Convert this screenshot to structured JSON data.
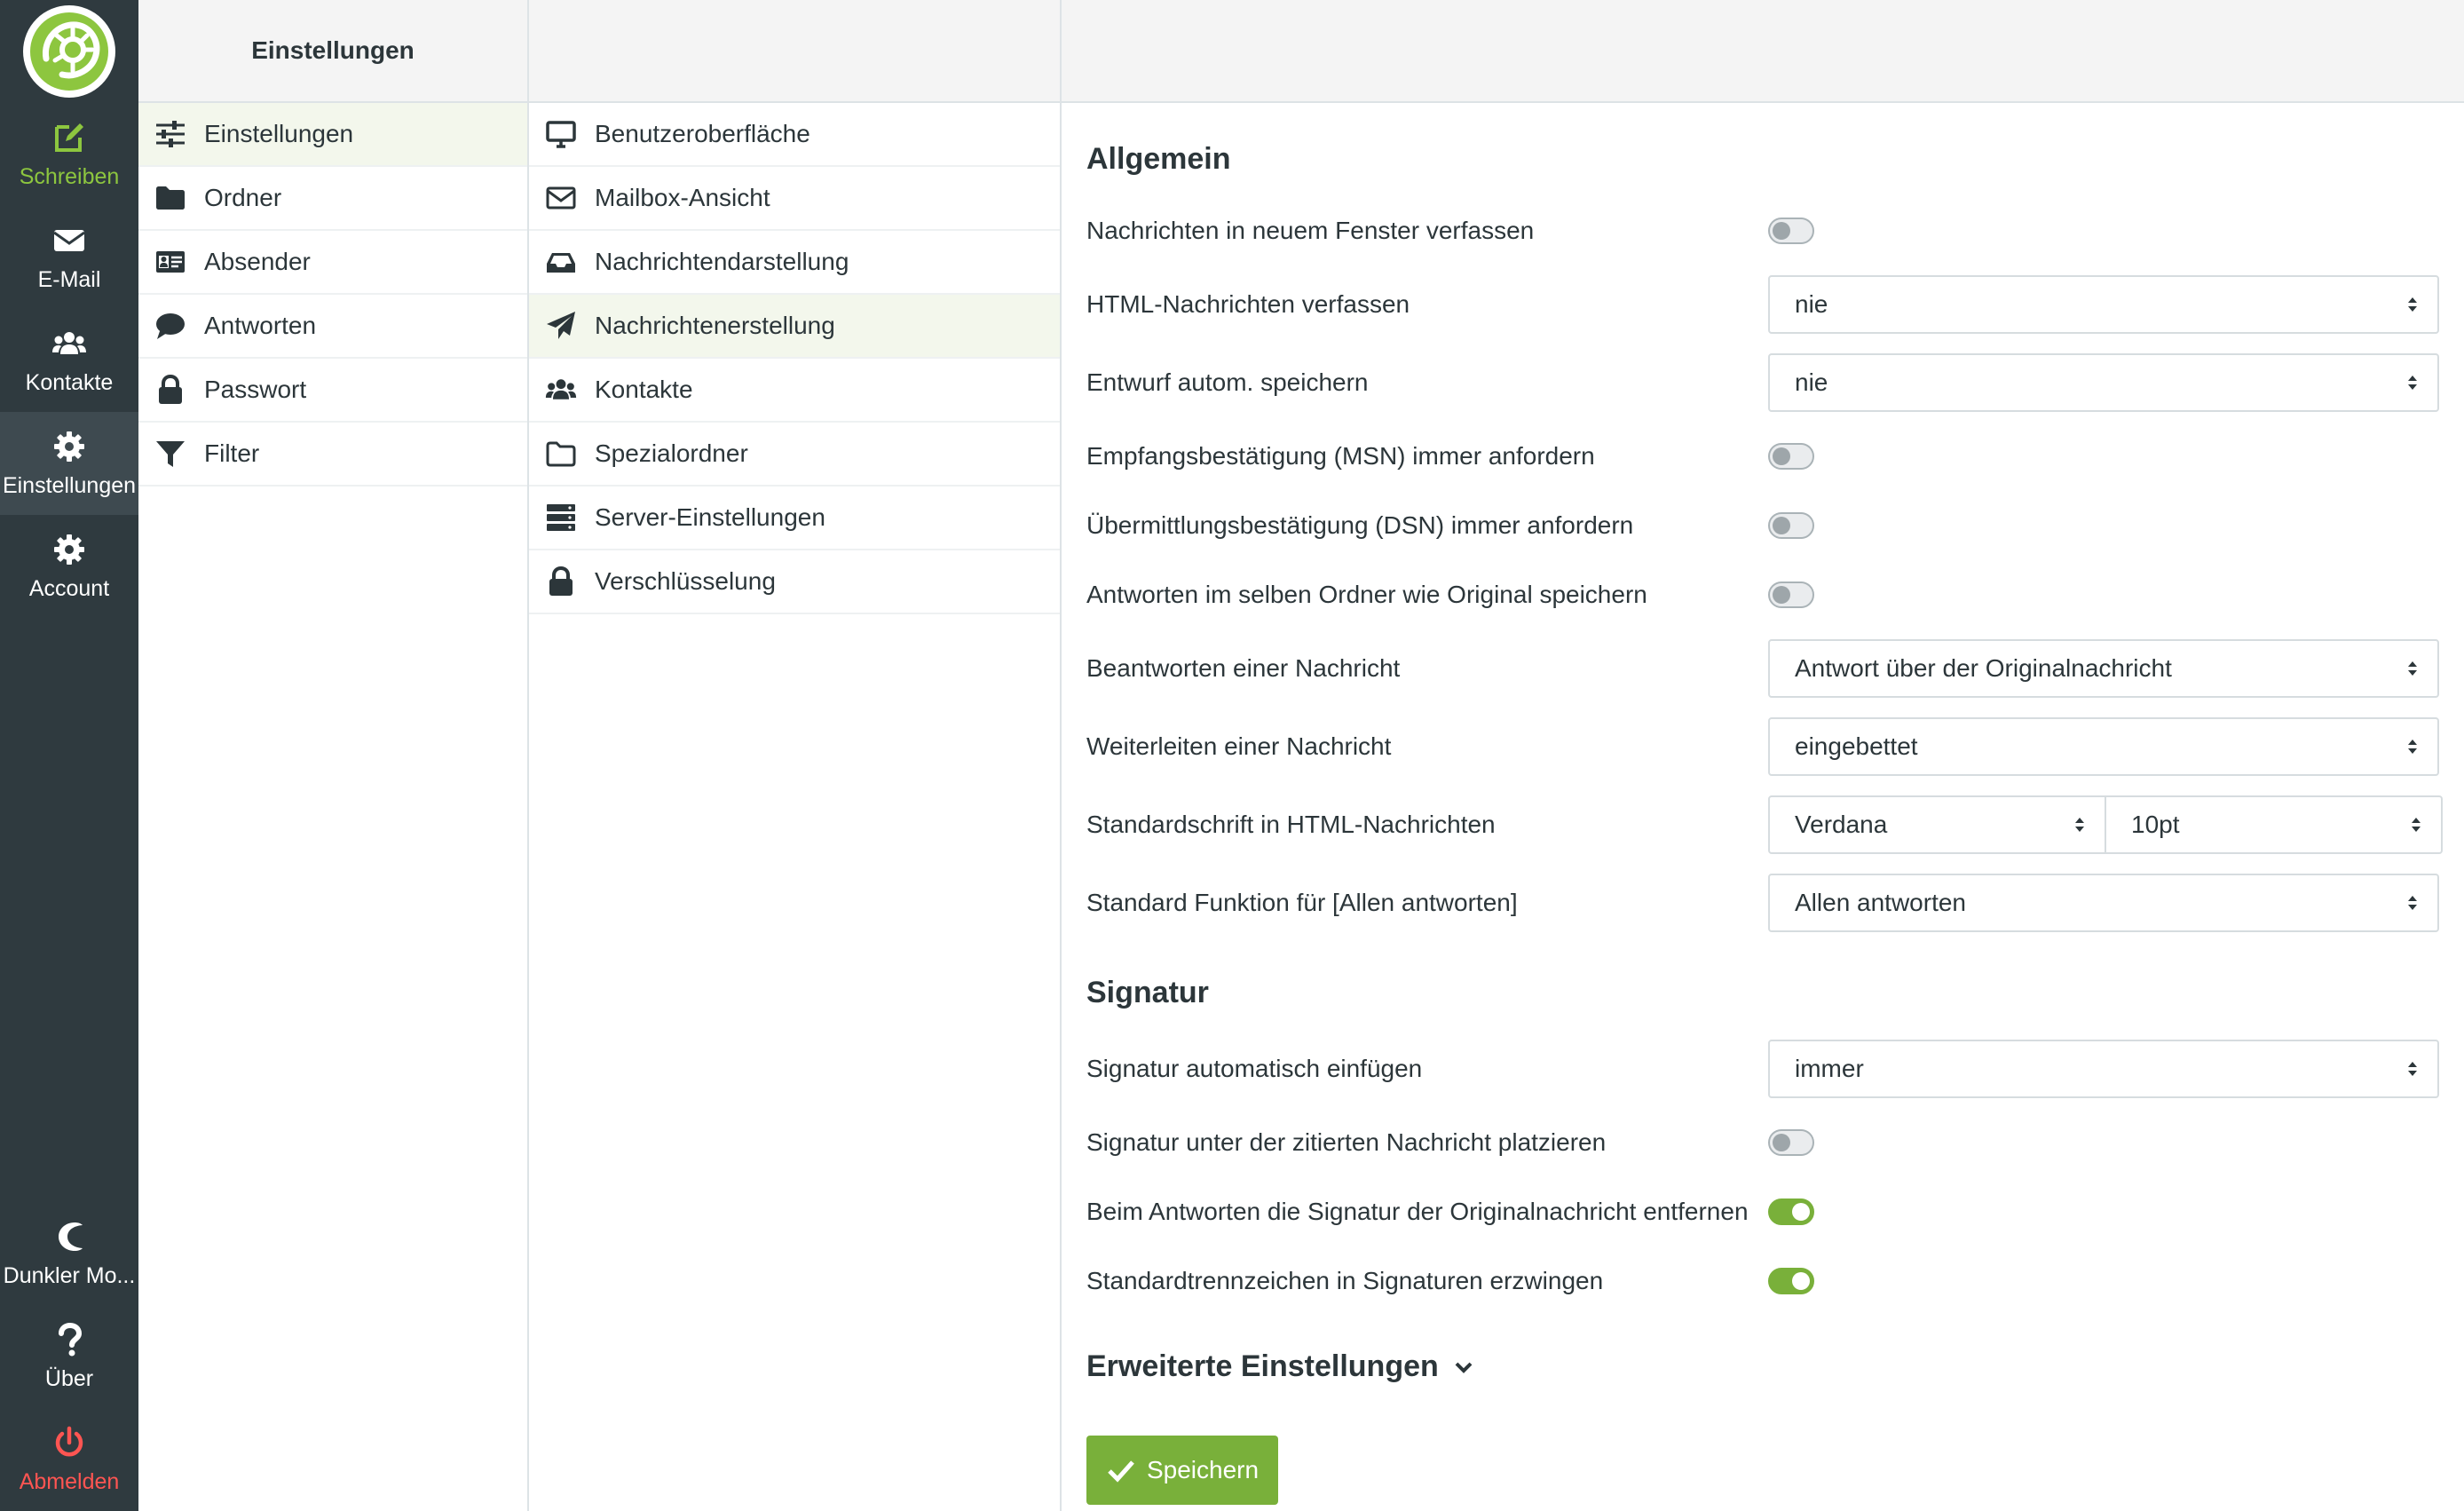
{
  "taskbar": {
    "top": [
      {
        "id": "compose",
        "label": "Schreiben",
        "icon": "compose-icon"
      },
      {
        "id": "mail",
        "label": "E-Mail",
        "icon": "envelope-icon"
      },
      {
        "id": "contacts",
        "label": "Kontakte",
        "icon": "users-icon"
      },
      {
        "id": "settings",
        "label": "Einstellungen",
        "icon": "gear-icon"
      },
      {
        "id": "account",
        "label": "Account",
        "icon": "gear-icon"
      }
    ],
    "bottom": [
      {
        "id": "darkmode",
        "label": "Dunkler Mo...",
        "icon": "moon-icon"
      },
      {
        "id": "about",
        "label": "Über",
        "icon": "question-icon"
      },
      {
        "id": "logout",
        "label": "Abmelden",
        "icon": "power-icon"
      }
    ]
  },
  "sections": {
    "header": "Einstellungen",
    "items": [
      {
        "label": "Einstellungen",
        "icon": "sliders-icon"
      },
      {
        "label": "Ordner",
        "icon": "folder-icon"
      },
      {
        "label": "Absender",
        "icon": "id-card-icon"
      },
      {
        "label": "Antworten",
        "icon": "speech-bubble-icon"
      },
      {
        "label": "Passwort",
        "icon": "lock-icon"
      },
      {
        "label": "Filter",
        "icon": "filter-icon"
      }
    ]
  },
  "subsections": {
    "items": [
      {
        "label": "Benutzeroberfläche",
        "icon": "monitor-icon"
      },
      {
        "label": "Mailbox-Ansicht",
        "icon": "envelope-outline-icon"
      },
      {
        "label": "Nachrichtendarstellung",
        "icon": "inbox-icon"
      },
      {
        "label": "Nachrichtenerstellung",
        "icon": "paper-plane-icon"
      },
      {
        "label": "Kontakte",
        "icon": "users-icon"
      },
      {
        "label": "Spezialordner",
        "icon": "folder-outline-icon"
      },
      {
        "label": "Server-Einstellungen",
        "icon": "server-icon"
      },
      {
        "label": "Verschlüsselung",
        "icon": "lock-icon"
      }
    ]
  },
  "content": {
    "general_title": "Allgemein",
    "general": {
      "new_window": {
        "label": "Nachrichten in neuem Fenster verfassen",
        "on": false
      },
      "html_compose": {
        "label": "HTML-Nachrichten verfassen",
        "value": "nie"
      },
      "draft_autosave": {
        "label": "Entwurf autom. speichern",
        "value": "nie"
      },
      "mdn": {
        "label": "Empfangsbestätigung (MSN) immer anfordern",
        "on": false
      },
      "dsn": {
        "label": "Übermittlungsbestätigung (DSN) immer anfordern",
        "on": false
      },
      "reply_same_folder": {
        "label": "Antworten im selben Ordner wie Original speichern",
        "on": false
      },
      "reply_mode": {
        "label": "Beantworten einer Nachricht",
        "value": "Antwort über der Originalnachricht"
      },
      "forward_mode": {
        "label": "Weiterleiten einer Nachricht",
        "value": "eingebettet"
      },
      "default_font": {
        "label": "Standardschrift in HTML-Nachrichten",
        "font": "Verdana",
        "size": "10pt"
      },
      "reply_all": {
        "label": "Standard Funktion für [Allen antworten]",
        "value": "Allen antworten"
      }
    },
    "signature_title": "Signatur",
    "signature": {
      "auto_insert": {
        "label": "Signatur automatisch einfügen",
        "value": "immer"
      },
      "below_quote": {
        "label": "Signatur unter der zitierten Nachricht platzieren",
        "on": false
      },
      "strip_on_reply": {
        "label": "Beim Antworten die Signatur der Originalnachricht entfernen",
        "on": true
      },
      "force_separator": {
        "label": "Standardtrennzeichen in Signaturen erzwingen",
        "on": true
      }
    },
    "advanced_label": "Erweiterte Einstellungen",
    "save_label": "Speichern"
  },
  "colors": {
    "accent": "#79b03a",
    "taskbar_bg": "#2f3a3f",
    "logout": "#ff5552"
  }
}
